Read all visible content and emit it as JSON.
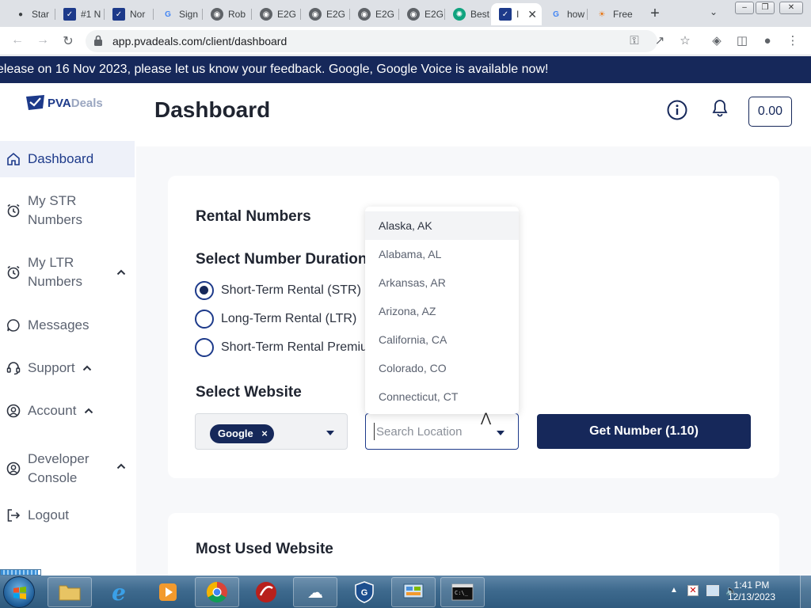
{
  "browser": {
    "tabs": [
      {
        "label": "Star",
        "icon": "app-icon",
        "color": "#3c4043"
      },
      {
        "label": "#1 N",
        "icon": "pva-icon",
        "color": "#1d3a8a"
      },
      {
        "label": "Nor",
        "icon": "pva-icon",
        "color": "#1d3a8a"
      },
      {
        "label": "Sign",
        "icon": "google-icon",
        "color": "#4285f4"
      },
      {
        "label": "Rob",
        "icon": "globe-icon",
        "color": "#5f6368"
      },
      {
        "label": "E2G",
        "icon": "globe-icon",
        "color": "#5f6368"
      },
      {
        "label": "E2G",
        "icon": "globe-icon",
        "color": "#5f6368"
      },
      {
        "label": "E2G",
        "icon": "globe-icon",
        "color": "#5f6368"
      },
      {
        "label": "E2G",
        "icon": "globe-icon",
        "color": "#5f6368"
      },
      {
        "label": "Best",
        "icon": "chatgpt-icon",
        "color": "#10a37f"
      },
      {
        "label": "I",
        "icon": "pva-icon",
        "color": "#1d3a8a"
      },
      {
        "label": "how",
        "icon": "google-icon",
        "color": "#4285f4"
      },
      {
        "label": "Free",
        "icon": "rainbow-icon",
        "color": "#e8710a"
      }
    ],
    "url": "app.pvadeals.com/client/dashboard"
  },
  "banner": {
    "text": "elease on 16 Nov 2023, please let us know your feedback. Google, Google Voice is available now!"
  },
  "sidebar": {
    "logo_brand": "PVA",
    "logo_rest": "Deals",
    "items": [
      {
        "label": "Dashboard"
      },
      {
        "label_line1": "My STR",
        "label_line2": "Numbers"
      },
      {
        "label_line1": "My LTR",
        "label_line2": "Numbers"
      },
      {
        "label": "Messages"
      },
      {
        "label": "Support"
      },
      {
        "label": "Account"
      },
      {
        "label_line1": "Developer",
        "label_line2": "Console"
      },
      {
        "label": "Logout"
      }
    ]
  },
  "header": {
    "title": "Dashboard",
    "balance": "0.00"
  },
  "rental": {
    "title": "Rental Numbers",
    "duration_title": "Select Number Duration",
    "options": [
      {
        "label": "Short-Term Rental (STR)",
        "selected": true
      },
      {
        "label": "Long-Term Rental (LTR)",
        "selected": false
      },
      {
        "label": "Short-Term Rental Premium",
        "selected": false
      }
    ],
    "website_title": "Select Website",
    "selected_website": "Google",
    "chip_remove": "×",
    "location_placeholder": "Search Location",
    "location_value": "",
    "get_number_label": "Get Number (1.10)",
    "location_options": [
      "Alaska, AK",
      "Alabama, AL",
      "Arkansas, AR",
      "Arizona, AZ",
      "California, CA",
      "Colorado, CO",
      "Connecticut, CT"
    ]
  },
  "most_used": {
    "title": "Most Used Website"
  },
  "taskbar": {
    "time": "1:41 PM",
    "date": "12/13/2023"
  },
  "colors": {
    "brand": "#16285a",
    "accent": "#1d3a8a"
  }
}
